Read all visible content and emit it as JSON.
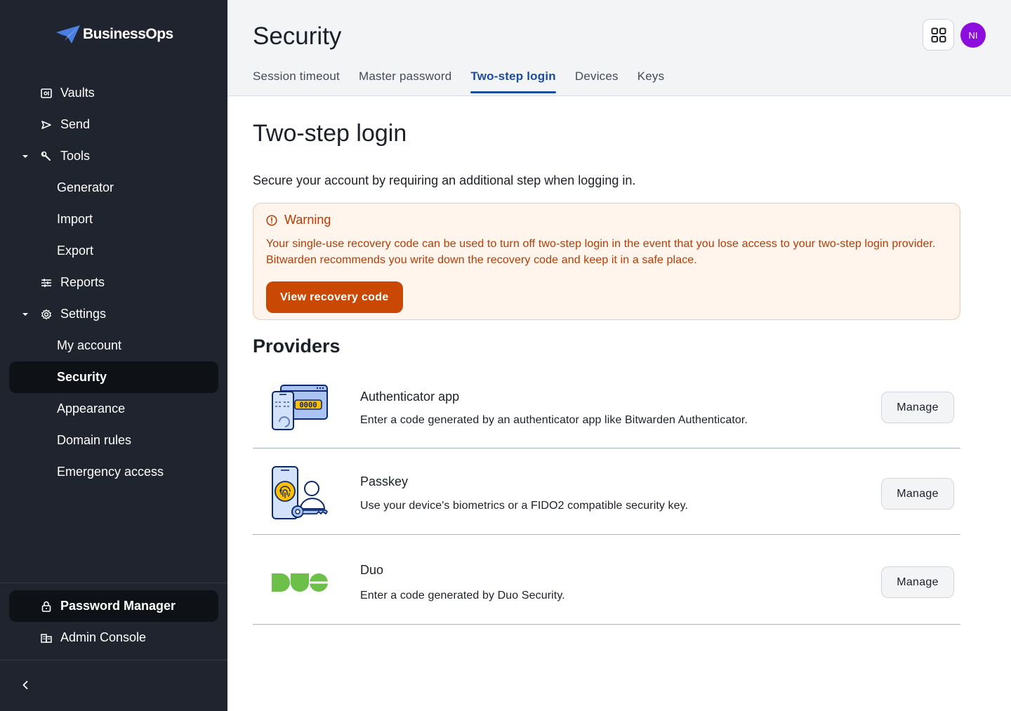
{
  "brand": {
    "name": "BusinessOps"
  },
  "sidebar": {
    "items": [
      {
        "label": "Vaults",
        "icon": "vault-icon"
      },
      {
        "label": "Send",
        "icon": "send-icon"
      },
      {
        "label": "Tools",
        "icon": "wrench-icon",
        "expanded": true
      },
      {
        "label": "Generator"
      },
      {
        "label": "Import"
      },
      {
        "label": "Export"
      },
      {
        "label": "Reports",
        "icon": "sliders-icon"
      },
      {
        "label": "Settings",
        "icon": "gear-icon",
        "expanded": true
      },
      {
        "label": "My account"
      },
      {
        "label": "Security",
        "active": true
      },
      {
        "label": "Appearance"
      },
      {
        "label": "Domain rules"
      },
      {
        "label": "Emergency access"
      }
    ],
    "products": [
      {
        "label": "Password Manager",
        "icon": "lock-icon",
        "active": true
      },
      {
        "label": "Admin Console",
        "icon": "business-icon"
      }
    ],
    "collapse_icon": "chevron-left-icon"
  },
  "header": {
    "title": "Security",
    "avatar_initials": "NI",
    "avatar_color": "#8d0ddf",
    "tabs": [
      {
        "label": "Session timeout"
      },
      {
        "label": "Master password"
      },
      {
        "label": "Two-step login",
        "active": true
      },
      {
        "label": "Devices"
      },
      {
        "label": "Keys"
      }
    ]
  },
  "main": {
    "heading": "Two-step login",
    "intro": "Secure your account by requiring an additional step when logging in.",
    "warning": {
      "title": "Warning",
      "body": "Your single-use recovery code can be used to turn off two-step login in the event that you lose access to your two-step login provider. Bitwarden recommends you write down the recovery code and keep it in a safe place.",
      "button": "View recovery code"
    },
    "providers_heading": "Providers",
    "providers": [
      {
        "name": "Authenticator app",
        "description": "Enter a code generated by an authenticator app like Bitwarden Authenticator.",
        "button": "Manage",
        "icon_text": "0000"
      },
      {
        "name": "Passkey",
        "description": "Use your device's biometrics or a FIDO2 compatible security key.",
        "button": "Manage"
      },
      {
        "name": "Duo",
        "description": "Enter a code generated by Duo Security.",
        "button": "Manage"
      }
    ]
  },
  "colors": {
    "sidebar_bg": "#1f242e",
    "accent": "#1a4d9e",
    "warning_text": "#b73b04",
    "warning_button": "#c94804",
    "duo_green": "#6cc04a"
  }
}
